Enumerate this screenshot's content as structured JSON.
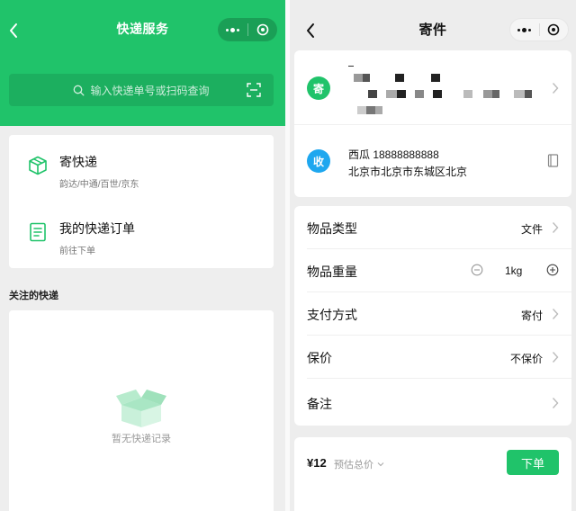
{
  "left": {
    "title": "快递服务",
    "search_placeholder": "输入快递单号或扫码查询",
    "services": [
      {
        "title": "寄快递",
        "subtitle": "韵达/中通/百世/京东"
      },
      {
        "title": "我的快递订单",
        "subtitle": "前往下单"
      }
    ],
    "section_label": "关注的快递",
    "empty_text": "暂无快递记录"
  },
  "right": {
    "title": "寄件",
    "sender_badge": "寄",
    "receiver_badge": "收",
    "receiver_name_phone": "西瓜 18888888888",
    "receiver_address": "北京市北京市东城区北京",
    "options": [
      {
        "label": "物品类型",
        "value": "文件"
      },
      {
        "label": "物品重量",
        "value": "1kg"
      },
      {
        "label": "支付方式",
        "value": "寄付"
      },
      {
        "label": "保价",
        "value": "不保价"
      },
      {
        "label": "备注",
        "value": ""
      }
    ],
    "price": "¥12",
    "estimate_label": "预估总价",
    "order_button": "下单"
  },
  "colors": {
    "brand_green": "#20c36a",
    "sender_badge": "#20c36a",
    "receiver_badge": "#1ea7ef"
  }
}
